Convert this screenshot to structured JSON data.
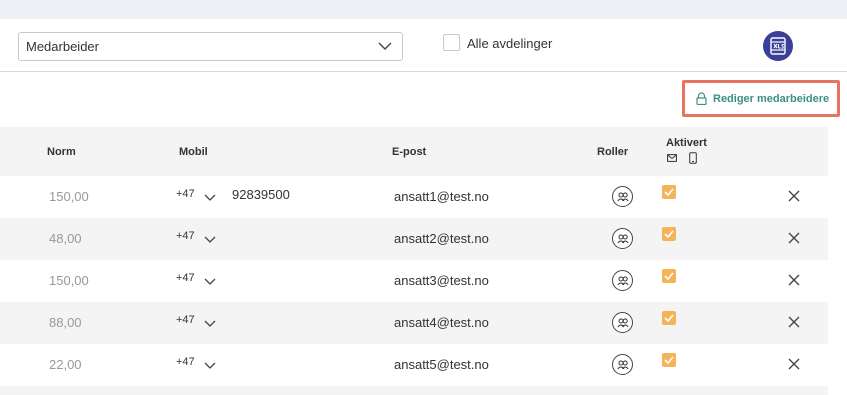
{
  "filters": {
    "select_value": "Medarbeider",
    "all_departments_label": "Alle avdelinger",
    "all_departments_checked": false,
    "export_icon": "xls-export-icon"
  },
  "actions": {
    "edit_label": "Rediger medarbeidere",
    "edit_icon": "lock-icon",
    "highlight_color": "#e8735f"
  },
  "table": {
    "headers": {
      "norm": "Norm",
      "mobile": "Mobil",
      "email": "E-post",
      "roles": "Roller",
      "activated": "Aktivert"
    },
    "rows": [
      {
        "norm": "150,00",
        "country_code": "+47",
        "mobile": "92839500",
        "email": "ansatt1@test.no",
        "activated": true
      },
      {
        "norm": "48,00",
        "country_code": "+47",
        "mobile": "",
        "email": "ansatt2@test.no",
        "activated": true
      },
      {
        "norm": "150,00",
        "country_code": "+47",
        "mobile": "",
        "email": "ansatt3@test.no",
        "activated": true
      },
      {
        "norm": "88,00",
        "country_code": "+47",
        "mobile": "",
        "email": "ansatt4@test.no",
        "activated": true
      },
      {
        "norm": "22,00",
        "country_code": "+47",
        "mobile": "",
        "email": "ansatt5@test.no",
        "activated": true
      }
    ]
  },
  "colors": {
    "accent_teal": "#3d8f82",
    "checkbox_orange": "#f5b35a",
    "xls_button": "#3b3f9a"
  }
}
